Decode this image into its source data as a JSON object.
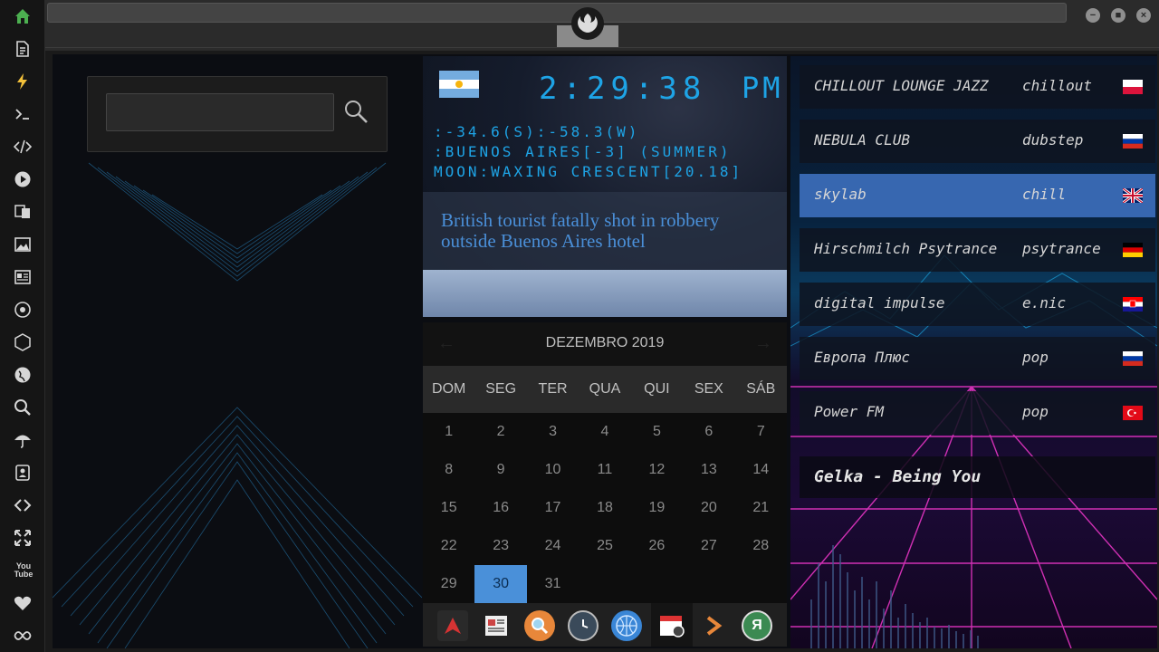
{
  "sidebar": {
    "icons": [
      "home-icon",
      "document-icon",
      "lightning-icon",
      "terminal-icon",
      "code-icon",
      "play-icon",
      "translate-icon",
      "image-icon",
      "news-icon",
      "rebel-icon",
      "hexagon-icon",
      "globe-icon",
      "search-icon",
      "umbrella-icon",
      "contacts-icon",
      "link-icon",
      "expand-icon",
      "youtube-icon",
      "heart-icon",
      "infinity-icon"
    ],
    "youtube_label": "You Tube"
  },
  "window": {
    "minimize": "−",
    "maximize": "■",
    "close": "×"
  },
  "search": {
    "placeholder": "",
    "value": ""
  },
  "clock": {
    "country_flag": "argentina-flag",
    "time": "2:29:38",
    "ampm": "PM",
    "coords": ":-34.6(S):-58.3(W)",
    "city": ":BUENOS AIRES[-3] (SUMMER)",
    "moon": "MOON:WAXING CRESCENT[20.18]",
    "headline": "British tourist fatally shot in robbery outside Buenos Aires hotel"
  },
  "calendar": {
    "month": "DEZEMBRO 2019",
    "prev": "←",
    "next": "→",
    "weekdays": [
      "DOM",
      "SEG",
      "TER",
      "QUA",
      "QUI",
      "SEX",
      "SÁB"
    ],
    "days": [
      "1",
      "2",
      "3",
      "4",
      "5",
      "6",
      "7",
      "8",
      "9",
      "10",
      "11",
      "12",
      "13",
      "14",
      "15",
      "16",
      "17",
      "18",
      "19",
      "20",
      "21",
      "22",
      "23",
      "24",
      "25",
      "26",
      "27",
      "28",
      "29",
      "30",
      "31"
    ],
    "selected": "30"
  },
  "dock": {
    "apps": [
      "arch-icon",
      "newspaper-icon",
      "magnifier-icon",
      "clock-icon",
      "globe-icon",
      "calendar-icon",
      "arrow-icon",
      "yandex-icon"
    ],
    "yandex_glyph": "Я"
  },
  "radio": {
    "stations": [
      {
        "name": "CHILLOUT LOUNGE JAZZ",
        "genre": "chillout",
        "flag": "poland-flag"
      },
      {
        "name": "NEBULA CLUB",
        "genre": "dubstep",
        "flag": "russia-flag"
      },
      {
        "name": "skylab",
        "genre": "chill",
        "flag": "uk-flag"
      },
      {
        "name": "Hirschmilch Psytrance",
        "genre": "psytrance",
        "flag": "germany-flag"
      },
      {
        "name": "digital impulse",
        "genre": "e.nic",
        "flag": "croatia-flag"
      },
      {
        "name": "Европа Плюс",
        "genre": "pop",
        "flag": "russia-flag"
      },
      {
        "name": "Power FM",
        "genre": "pop",
        "flag": "turkey-flag"
      }
    ],
    "active_index": 2,
    "now_playing": "Gelka - Being You"
  }
}
